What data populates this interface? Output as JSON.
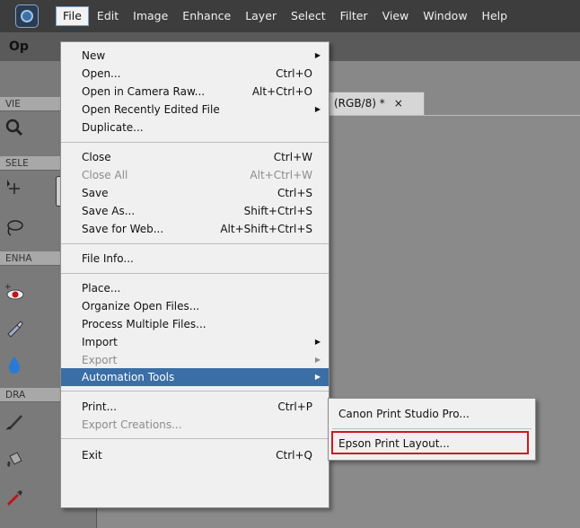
{
  "menubar": {
    "items": [
      "File",
      "Edit",
      "Image",
      "Enhance",
      "Layer",
      "Select",
      "Filter",
      "View",
      "Window",
      "Help"
    ]
  },
  "mode_title": "Op",
  "panel": {
    "sections": [
      "VIE",
      "SELE",
      "ENHA",
      "DRA"
    ]
  },
  "document_tab": {
    "label": "(RGB/8) *",
    "close": "×"
  },
  "file_menu": {
    "items": [
      {
        "label": "New",
        "shortcut": "",
        "submenu": true,
        "disabled": false
      },
      {
        "label": "Open...",
        "shortcut": "Ctrl+O",
        "submenu": false,
        "disabled": false
      },
      {
        "label": "Open in Camera Raw...",
        "shortcut": "Alt+Ctrl+O",
        "submenu": false,
        "disabled": false
      },
      {
        "label": "Open Recently Edited File",
        "shortcut": "",
        "submenu": true,
        "disabled": false
      },
      {
        "label": "Duplicate...",
        "shortcut": "",
        "submenu": false,
        "disabled": false
      },
      {
        "label": "Close",
        "shortcut": "Ctrl+W",
        "submenu": false,
        "disabled": false
      },
      {
        "label": "Close All",
        "shortcut": "Alt+Ctrl+W",
        "submenu": false,
        "disabled": true
      },
      {
        "label": "Save",
        "shortcut": "Ctrl+S",
        "submenu": false,
        "disabled": false
      },
      {
        "label": "Save As...",
        "shortcut": "Shift+Ctrl+S",
        "submenu": false,
        "disabled": false
      },
      {
        "label": "Save for Web...",
        "shortcut": "Alt+Shift+Ctrl+S",
        "submenu": false,
        "disabled": false
      },
      {
        "label": "File Info...",
        "shortcut": "",
        "submenu": false,
        "disabled": false
      },
      {
        "label": "Place...",
        "shortcut": "",
        "submenu": false,
        "disabled": false
      },
      {
        "label": "Organize Open Files...",
        "shortcut": "",
        "submenu": false,
        "disabled": false
      },
      {
        "label": "Process Multiple Files...",
        "shortcut": "",
        "submenu": false,
        "disabled": false
      },
      {
        "label": "Import",
        "shortcut": "",
        "submenu": true,
        "disabled": false
      },
      {
        "label": "Export",
        "shortcut": "",
        "submenu": true,
        "disabled": true
      },
      {
        "label": "Automation Tools",
        "shortcut": "",
        "submenu": true,
        "disabled": false,
        "highlighted": true
      },
      {
        "label": "Print...",
        "shortcut": "Ctrl+P",
        "submenu": false,
        "disabled": false
      },
      {
        "label": "Export Creations...",
        "shortcut": "",
        "submenu": false,
        "disabled": true
      },
      {
        "label": "Exit",
        "shortcut": "Ctrl+Q",
        "submenu": false,
        "disabled": false
      }
    ]
  },
  "automation_submenu": {
    "items": [
      "Canon Print Studio Pro...",
      "Epson Print Layout..."
    ]
  },
  "colors": {
    "menubar_bg": "#3d3d3d",
    "menu_bg": "#f0f0f0",
    "highlight": "#3a6ea5",
    "callout_red": "#d01820"
  }
}
